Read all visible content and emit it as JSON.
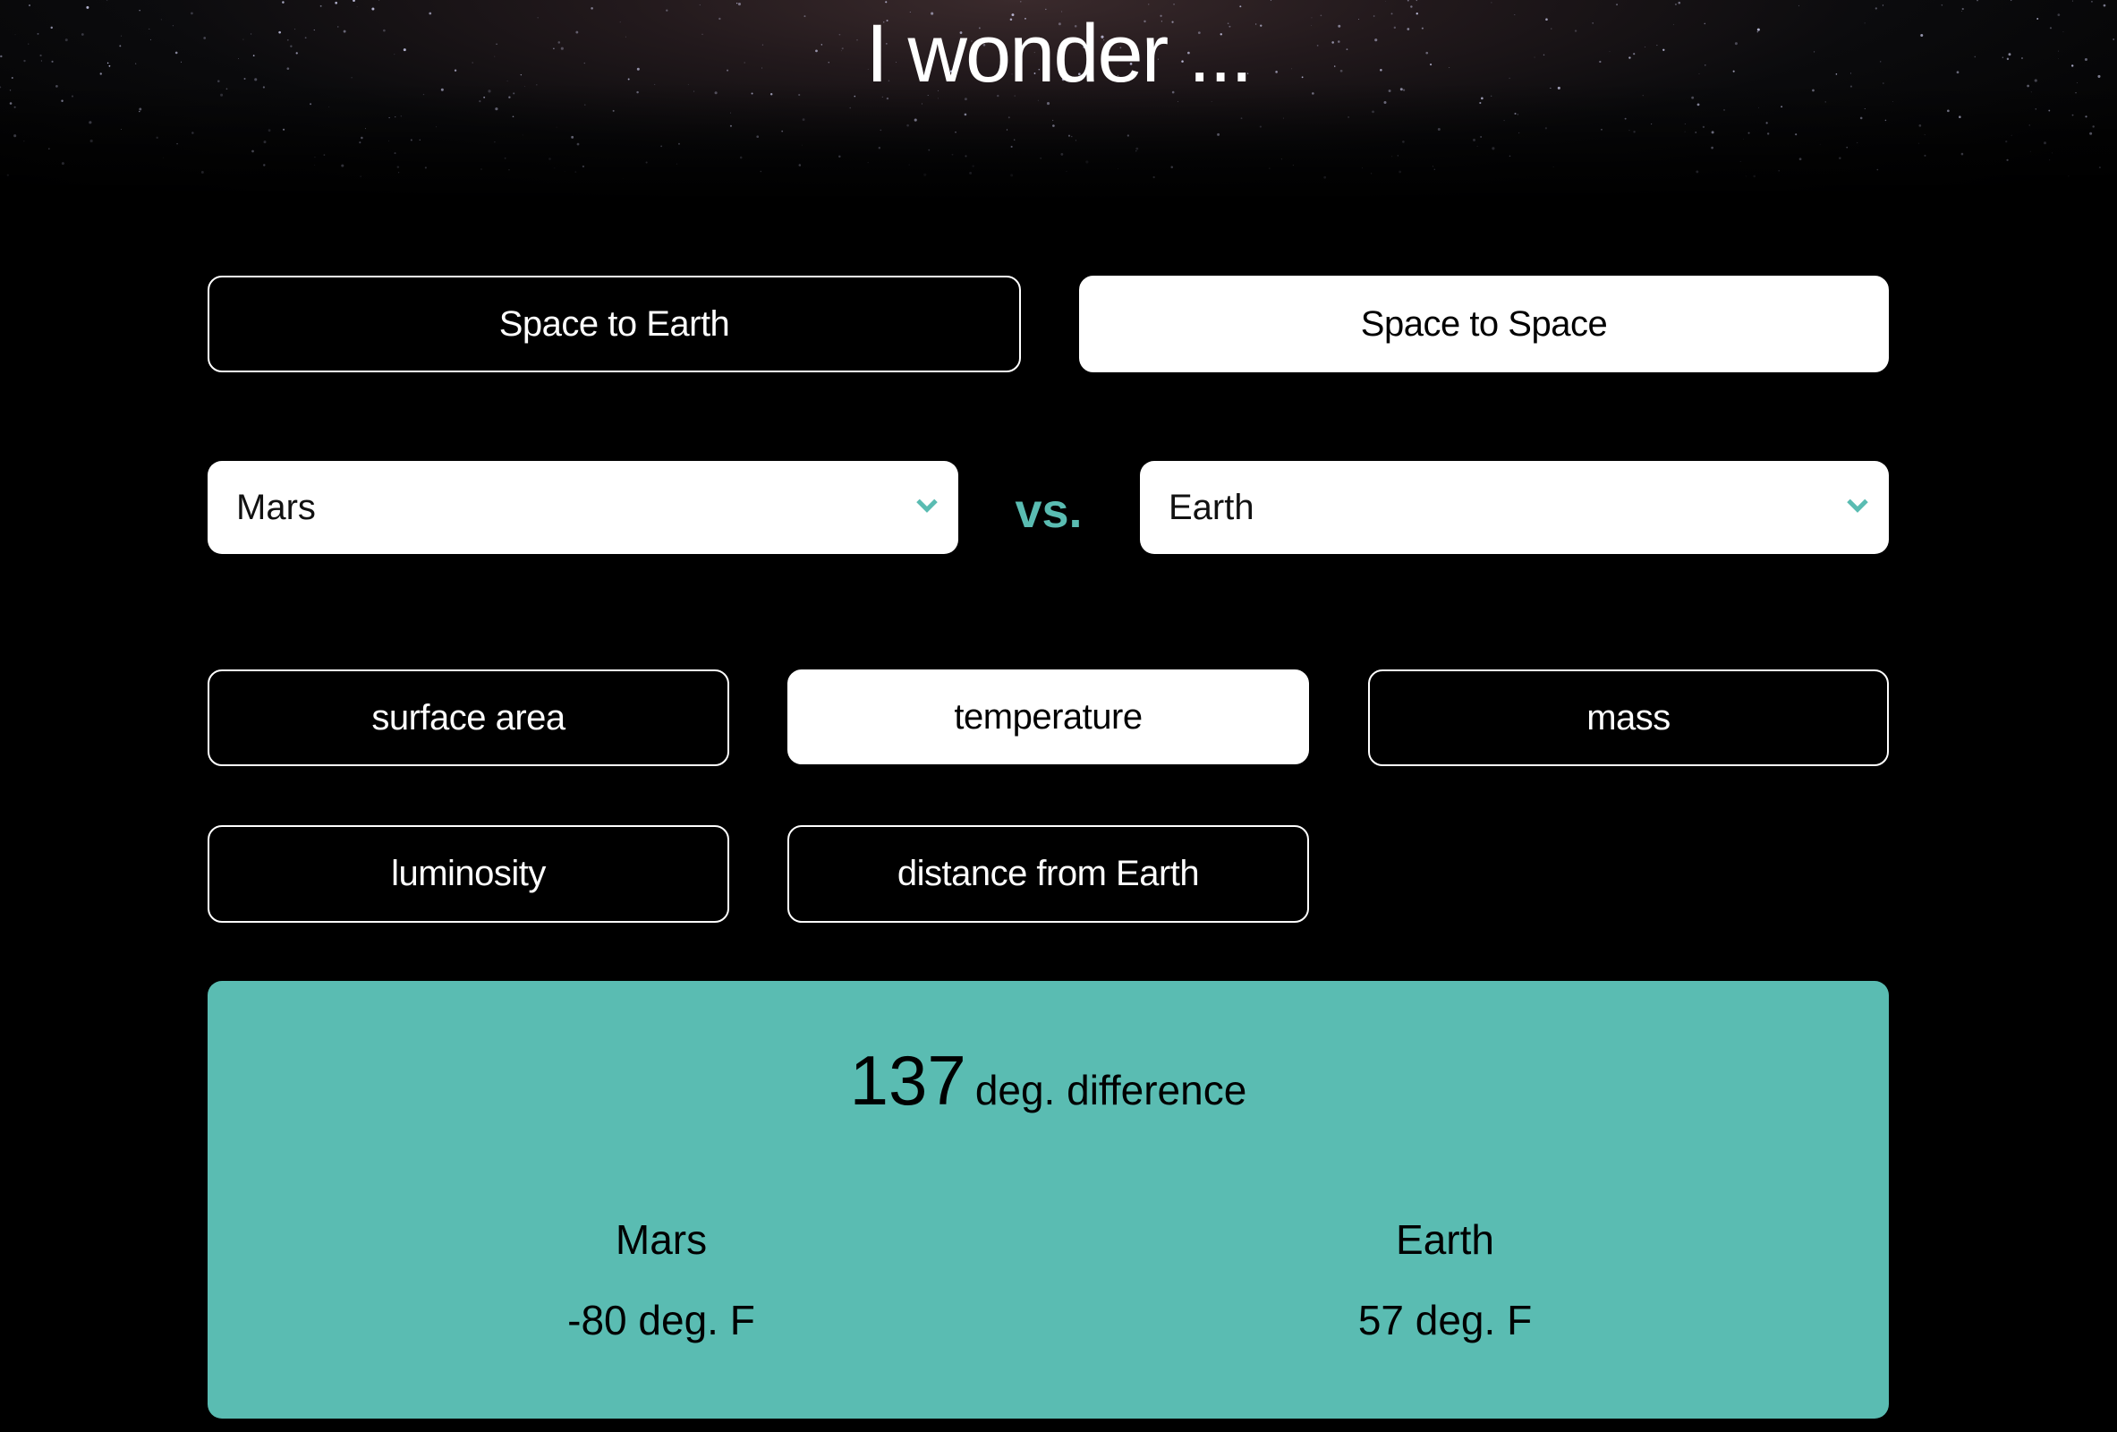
{
  "header": {
    "title": "I wonder ..."
  },
  "modes": [
    {
      "label": "Space to Earth",
      "active": false
    },
    {
      "label": "Space to Space",
      "active": true
    }
  ],
  "comparison": {
    "left_select": {
      "value": "Mars"
    },
    "vs_label": "vs.",
    "right_select": {
      "value": "Earth"
    }
  },
  "metrics": [
    {
      "label": "surface area",
      "active": false
    },
    {
      "label": "temperature",
      "active": true
    },
    {
      "label": "mass",
      "active": false
    },
    {
      "label": "luminosity",
      "active": false
    },
    {
      "label": "distance from Earth",
      "active": false
    }
  ],
  "result": {
    "difference_value": "137",
    "difference_unit": "deg. difference",
    "left": {
      "name": "Mars",
      "value": "-80 deg. F"
    },
    "right": {
      "name": "Earth",
      "value": "57 deg. F"
    }
  },
  "colors": {
    "accent": "#5abcb2",
    "background": "#000000",
    "active_button": "#ffffff"
  },
  "icons": {
    "select_chevron": "chevron-down-icon"
  }
}
